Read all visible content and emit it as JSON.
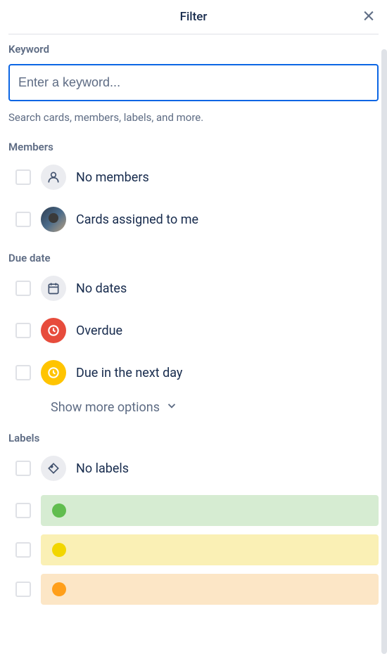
{
  "header": {
    "title": "Filter"
  },
  "keyword": {
    "label": "Keyword",
    "placeholder": "Enter a keyword...",
    "value": "",
    "help": "Search cards, members, labels, and more."
  },
  "members": {
    "label": "Members",
    "options": {
      "no_members": "No members",
      "assigned_to_me": "Cards assigned to me"
    }
  },
  "due_date": {
    "label": "Due date",
    "options": {
      "no_dates": "No dates",
      "overdue": "Overdue",
      "next_day": "Due in the next day"
    },
    "show_more": "Show more options"
  },
  "labels": {
    "label": "Labels",
    "no_labels": "No labels",
    "colors": {
      "green": "#61bd4f",
      "yellow": "#f2d600",
      "orange": "#ff9f1a"
    }
  }
}
